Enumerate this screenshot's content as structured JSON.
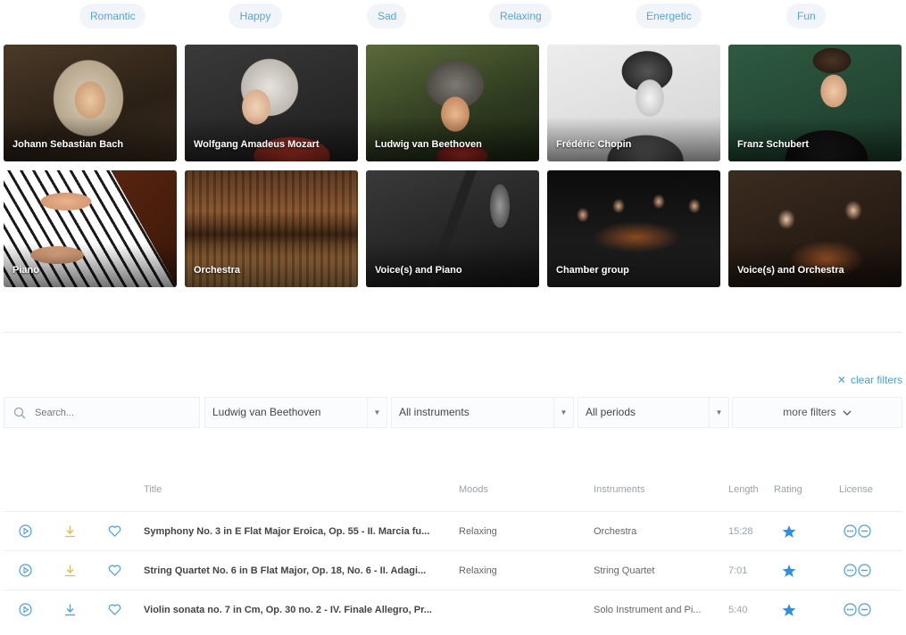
{
  "moods": [
    "Romantic",
    "Happy",
    "Sad",
    "Relaxing",
    "Energetic",
    "Fun"
  ],
  "composers": [
    {
      "label": "Johann Sebastian Bach"
    },
    {
      "label": "Wolfgang Amadeus Mozart"
    },
    {
      "label": "Ludwig van Beethoven"
    },
    {
      "label": "Frédéric Chopin"
    },
    {
      "label": "Franz Schubert"
    }
  ],
  "ensembles": [
    {
      "label": "Piano"
    },
    {
      "label": "Orchestra"
    },
    {
      "label": "Voice(s) and Piano"
    },
    {
      "label": "Chamber group"
    },
    {
      "label": "Voice(s) and Orchestra"
    }
  ],
  "clear_filters": "clear filters",
  "filters": {
    "search_placeholder": "Search...",
    "composer": "Ludwig van Beethoven",
    "instruments": "All instruments",
    "periods": "All periods",
    "more": "more filters"
  },
  "table": {
    "headers": {
      "title": "Title",
      "moods": "Moods",
      "instruments": "Instruments",
      "length": "Length",
      "rating": "Rating",
      "license": "License"
    },
    "rows": [
      {
        "title": "Symphony No. 3 in E Flat Major Eroica, Op. 55 - II. Marcia fu...",
        "mood": "Relaxing",
        "instruments": "Orchestra",
        "length": "15:28"
      },
      {
        "title": "String Quartet No. 6 in B Flat Major, Op. 18, No. 6 - II. Adagi...",
        "mood": "Relaxing",
        "instruments": "String Quartet",
        "length": "7:01"
      },
      {
        "title": "Violin sonata no. 7 in Cm, Op. 30 no. 2 - IV. Finale Allegro, Pr...",
        "mood": "",
        "instruments": "Solo Instrument and Pi...",
        "length": "5:40"
      }
    ]
  },
  "colors": {
    "accent": "#4a9fe0",
    "download": "#e6b84a",
    "star": "#2f8fde"
  }
}
